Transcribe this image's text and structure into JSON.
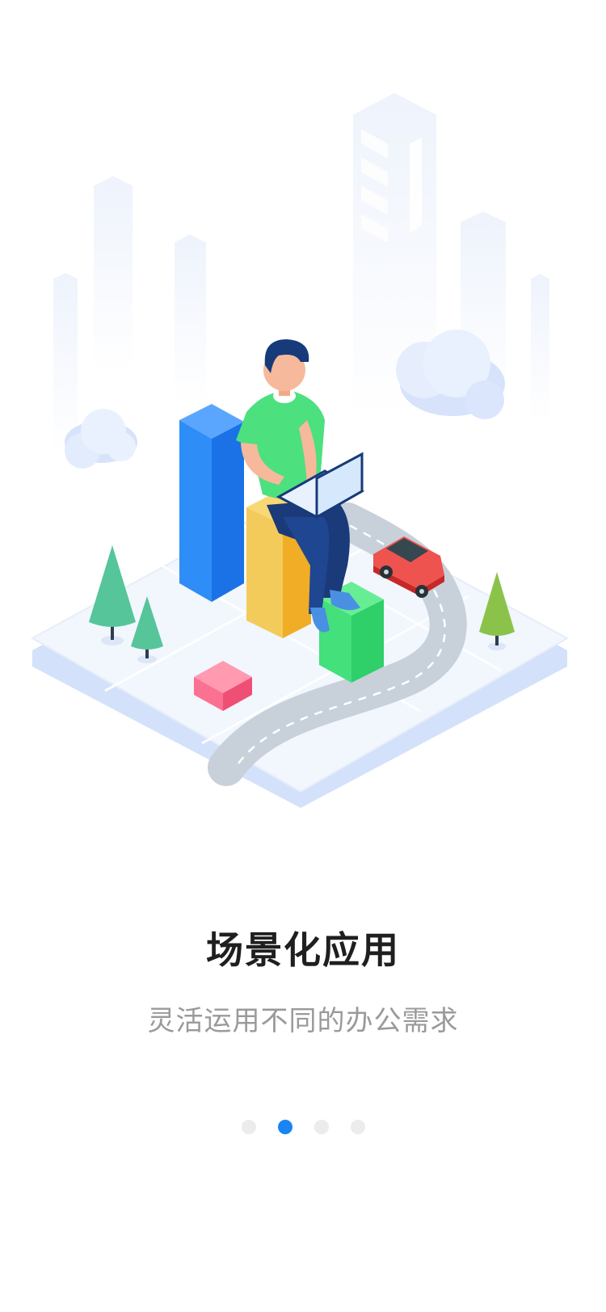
{
  "onboarding": {
    "title": "场景化应用",
    "subtitle": "灵活运用不同的办公需求",
    "pagination": {
      "total": 4,
      "active_index": 1,
      "active_color": "#1a84f2",
      "inactive_color": "#ececec"
    }
  },
  "illustration": {
    "subject": "person-with-laptop-on-bar-chart-isometric-city"
  }
}
